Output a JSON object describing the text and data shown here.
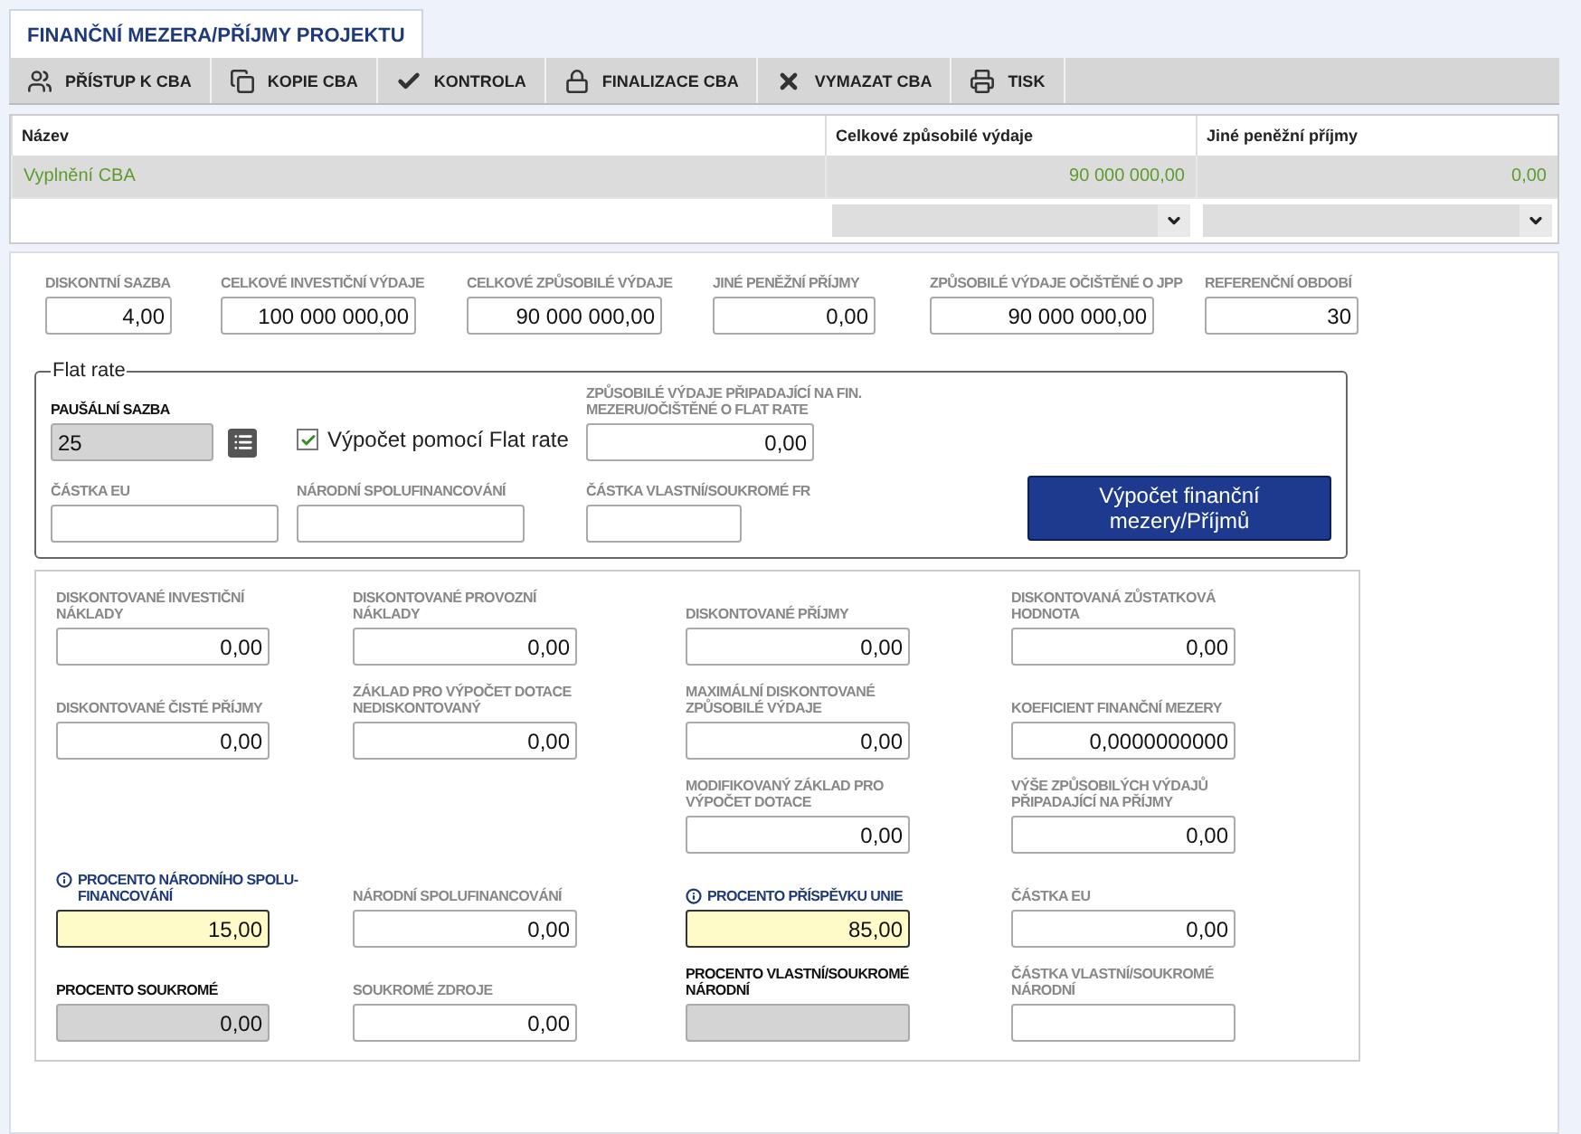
{
  "tab": {
    "label": "FINANČNÍ MEZERA/PŘÍJMY PROJEKTU",
    "selected": true
  },
  "toolbar": [
    "PŘÍSTUP K CBA",
    "KOPIE CBA",
    "KONTROLA",
    "FINALIZACE CBA",
    "VYMAZAT CBA",
    "TISK"
  ],
  "table": {
    "columns": [
      "Název",
      "Celkové způsobilé výdaje",
      "Jiné peněžní příjmy"
    ],
    "rows": [
      {
        "cells": [
          "Vyplnění CBA",
          "90 000 000,00",
          "0,00"
        ],
        "selected": true
      }
    ]
  },
  "top_fields": [
    {
      "label": "DISKONTNÍ SAZBA",
      "value": "4,00"
    },
    {
      "label": "CELKOVÉ INVESTIČNÍ VÝDAJE",
      "value": "100 000 000,00"
    },
    {
      "label": "CELKOVÉ ZPŮSOBILÉ VÝDAJE",
      "value": "90 000 000,00"
    },
    {
      "label": "JINÉ PENĚŽNÍ PŘÍJMY",
      "value": "0,00"
    },
    {
      "label": "ZPŮSOBILÉ VÝDAJE OČIŠTĚNÉ O JPP",
      "value": "90 000 000,00"
    },
    {
      "label": "REFERENČNÍ OBDOBÍ",
      "value": "30"
    }
  ],
  "flat_rate": {
    "legend": "Flat rate",
    "rate": {
      "label": "PAUŠÁLNÍ SAZBA",
      "value": "25"
    },
    "checkbox": {
      "label": "Výpočet pomocí Flat rate",
      "checked": true
    },
    "eligible": {
      "label": "ZPŮSOBILÉ VÝDAJE PŘIPADAJÍCÍ NA FIN. MEZERU/OČIŠTĚNÉ O FLAT RATE",
      "value": "0,00"
    },
    "fields": [
      {
        "label": "ČÁSTKA EU"
      },
      {
        "label": "NÁRODNÍ SPOLUFINANCOVÁNÍ"
      },
      {
        "label": "ČÁSTKA VLASTNÍ/SOUKROMÉ FR"
      }
    ],
    "button": "Výpočet finanční mezery/Příjmů"
  },
  "results": [
    [
      {
        "kind": "plain",
        "label": "DISKONTOVANÉ INVESTIČNÍ NÁKLADY",
        "value": "0,00"
      },
      {
        "kind": "plain",
        "label": "DISKONTOVANÉ PROVOZNÍ NÁKLADY",
        "value": "0,00"
      },
      {
        "kind": "plain",
        "label": "DISKONTOVANÉ PŘÍJMY",
        "value": "0,00"
      },
      {
        "kind": "plain",
        "label": "DISKONTOVANÁ ZŮSTATKOVÁ HODNOTA",
        "value": "0,00"
      }
    ],
    [
      {
        "kind": "plain",
        "label": "DISKONTOVANÉ ČISTÉ PŘÍJMY",
        "value": "0,00"
      },
      {
        "kind": "plain",
        "label": "ZÁKLAD PRO VÝPOČET DOTACE NEDISKONTOVANÝ",
        "value": "0,00"
      },
      {
        "kind": "plain",
        "label": "MAXIMÁLNÍ DISKONTOVANÉ ZPŮSOBILÉ VÝDAJE",
        "value": "0,00"
      },
      {
        "kind": "plain",
        "label": "KOEFICIENT FINANČNÍ MEZERY",
        "value": "0,0000000000"
      }
    ],
    [
      {
        "kind": "blank"
      },
      {
        "kind": "blank"
      },
      {
        "kind": "plain",
        "label": "MODIFIKOVANÝ ZÁKLAD PRO VÝPOČET DOTACE",
        "value": "0,00"
      },
      {
        "kind": "plain",
        "label": "VÝŠE ZPŮSOBILÝCH VÝDAJŮ PŘIPADAJÍCÍ NA PŘÍJMY",
        "value": "0,00"
      }
    ],
    [
      {
        "kind": "required",
        "label": "PROCENTO NÁRODNÍHO SPOLU-FINANCOVÁNÍ",
        "value": "15,00"
      },
      {
        "kind": "plain",
        "label": "NÁRODNÍ SPOLUFINANCOVÁNÍ",
        "value": "0,00"
      },
      {
        "kind": "required",
        "label": "PROCENTO PŘÍSPĚVKU UNIE",
        "value": "85,00"
      },
      {
        "kind": "plain",
        "label": "ČÁSTKA EU",
        "value": "0,00"
      }
    ],
    [
      {
        "kind": "locked",
        "label": "PROCENTO SOUKROMÉ",
        "value": "0,00"
      },
      {
        "kind": "plain",
        "label": "SOUKROMÉ ZDROJE",
        "value": "0,00"
      },
      {
        "kind": "locked",
        "label": "PROCENTO VLASTNÍ/SOUKROMÉ NÁRODNÍ"
      },
      {
        "kind": "plain",
        "label": "ČÁSTKA VLASTNÍ/SOUKROMÉ NÁRODNÍ"
      }
    ]
  ]
}
